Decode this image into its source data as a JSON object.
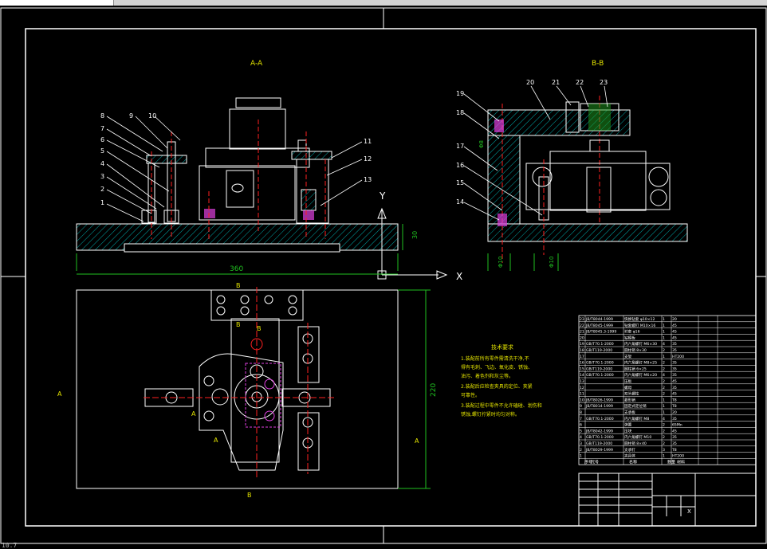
{
  "window": {
    "title": ""
  },
  "section_titles": {
    "aa": "A-A",
    "bb": "B-B"
  },
  "callouts_left": [
    "1",
    "2",
    "3",
    "4",
    "5",
    "6",
    "7",
    "8",
    "9",
    "10",
    "11",
    "12",
    "13"
  ],
  "callouts_right": [
    "14",
    "15",
    "16",
    "17",
    "18",
    "19",
    "20",
    "21",
    "22",
    "23"
  ],
  "dimensions": {
    "length": "360",
    "width": "220",
    "height": "30",
    "hole_small": "Φ8",
    "hole_dia_a": "Φ10",
    "hole_dia_b": "Φ10"
  },
  "section_markers": {
    "A": "A",
    "B": "B"
  },
  "axis_labels": {
    "x": "X",
    "y": "Y"
  },
  "notes": {
    "title": "技术要求",
    "lines": [
      "1.装配前所有零件需清洗干净,不",
      "得有毛刺、飞边、氧化皮、锈蚀、",
      "油污、着色剂和灰尘等。",
      "2.装配后应检查夹具的定位、夹紧",
      "可靠性。",
      "3.装配过程中零件不允许磕碰、划伤和",
      "锈蚀,螺钉拧紧时均匀对称。"
    ]
  },
  "bom_rows": [
    [
      "23",
      "JB/T8044-1999",
      "快换钻套 φ10×12",
      "1",
      "20"
    ],
    [
      "22",
      "JB/T8045-1999",
      "钻套螺钉 M10×16",
      "1",
      "45"
    ],
    [
      "21",
      "JB/T8045.3-1999",
      "衬套 φ16",
      "1",
      "45"
    ],
    [
      "20",
      "",
      "钻模板",
      "1",
      "45"
    ],
    [
      "19",
      "GB/T70.1-2000",
      "内六角螺钉 M6×30",
      "4",
      "35"
    ],
    [
      "18",
      "GB/T119-2000",
      "圆柱销 8×30",
      "2",
      "35"
    ],
    [
      "17",
      "",
      "支架",
      "1",
      "HT200"
    ],
    [
      "16",
      "GB/T70.1-2000",
      "内六角螺钉 M8×25",
      "2",
      "35"
    ],
    [
      "15",
      "GB/T119-2000",
      "圆柱销 6×25",
      "2",
      "35"
    ],
    [
      "14",
      "GB/T70.1-2000",
      "内六角螺钉 M6×20",
      "4",
      "35"
    ],
    [
      "13",
      "",
      "压板",
      "2",
      "45"
    ],
    [
      "12",
      "",
      "螺母",
      "2",
      "35"
    ],
    [
      "11",
      "",
      "双头螺柱",
      "2",
      "45"
    ],
    [
      "10",
      "JB/T8026-1999",
      "菱形销",
      "1",
      "T8"
    ],
    [
      "9",
      "JB/T8014-1999",
      "固定式定位销",
      "1",
      "T8"
    ],
    [
      "8",
      "",
      "支承板",
      "1",
      "20"
    ],
    [
      "7",
      "GB/T70.1-2000",
      "内六角螺钉 M8",
      "4",
      "35"
    ],
    [
      "6",
      "",
      "弹簧",
      "2",
      "65Mn"
    ],
    [
      "5",
      "JB/T8042-1999",
      "压块",
      "2",
      "45"
    ],
    [
      "4",
      "GB/T70.1-2000",
      "内六角螺钉 M10",
      "2",
      "35"
    ],
    [
      "3",
      "GB/T119-2000",
      "圆柱销 8×40",
      "2",
      "35"
    ],
    [
      "2",
      "JB/T8029-1999",
      "支承钉",
      "3",
      "T8"
    ],
    [
      "1",
      "",
      "夹具体",
      "1",
      "HT200"
    ]
  ],
  "bom_header": [
    "序号",
    "代号",
    "名称",
    "数量",
    "材料"
  ],
  "title_block": {
    "scale_mark": "X"
  },
  "status": {
    "coords": "10.7"
  },
  "colors": {
    "background": "#000000",
    "line_white": "#ffffff",
    "hatch_cyan": "#00b2b2",
    "center_red": "#ff2020",
    "dim_green": "#20c020",
    "label_yellow": "#e0e000",
    "magenta": "#e040e0"
  }
}
